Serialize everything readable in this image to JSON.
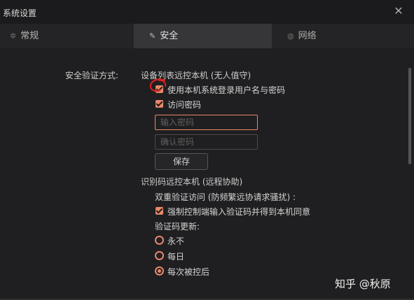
{
  "window": {
    "title": "系统设置",
    "close_glyph": "✕"
  },
  "tabs": [
    {
      "label": "常规",
      "icon": "gear-icon",
      "active": false
    },
    {
      "label": "安全",
      "icon": "shield-icon",
      "active": true
    },
    {
      "label": "网络",
      "icon": "globe-icon",
      "active": false
    }
  ],
  "security": {
    "verify_method_label": "安全验证方式:",
    "device_list_header": "设备列表远控本机 (无人值守)",
    "use_system_login_label": "使用本机系统登录用户名与密码",
    "use_system_login_checked": true,
    "access_password_label": "访问密码",
    "access_password_checked": true,
    "password_input": {
      "placeholder": "输入密码",
      "value": ""
    },
    "confirm_input": {
      "placeholder": "确认密码",
      "value": ""
    },
    "save_label": "保存",
    "id_code_header": "识别码远控本机 (远程协助)",
    "two_factor_label": "双重验证访问 (防频繁远协请求骚扰) :",
    "force_verify_label": "强制控制端输入验证码并得到本机同意",
    "force_verify_checked": true,
    "code_update_label": "验证码更新:",
    "update_options": [
      {
        "label": "永不",
        "selected": false
      },
      {
        "label": "每日",
        "selected": false
      },
      {
        "label": "每次被控后",
        "selected": true
      }
    ]
  },
  "colors": {
    "accent": "#e4896a",
    "annotation": "#e02020"
  },
  "watermark": "知乎 @秋原"
}
